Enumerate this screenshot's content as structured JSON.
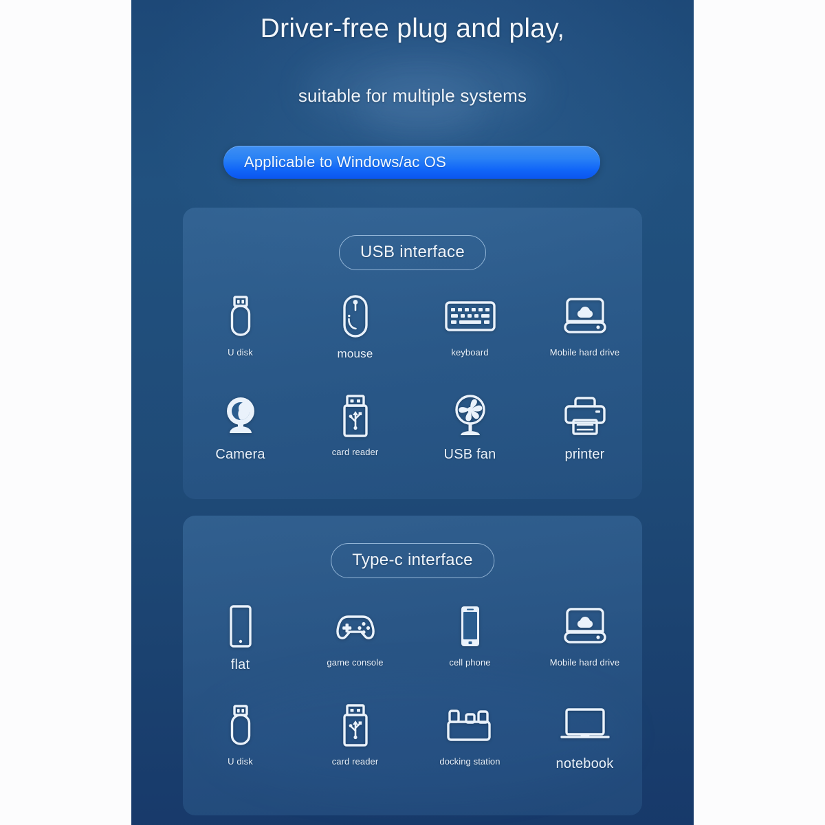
{
  "headline": "Driver-free plug and play,",
  "subheadline": "suitable for multiple systems",
  "os_button": {
    "label": "Applicable to Windows/ac OS"
  },
  "colors": {
    "background_top": "#1d4877",
    "background_bottom": "#17396a",
    "card": "#3d6e9f",
    "accent_button_light": "#3f8ff2",
    "accent_button_dark": "#0b56ef",
    "icon_stroke": "#eaf2fb",
    "text": "#f2f6fb"
  },
  "sections": [
    {
      "title": "USB interface",
      "rows": [
        [
          {
            "icon": "usb-flash-drive-icon",
            "label": "U disk",
            "size": "sm"
          },
          {
            "icon": "mouse-icon",
            "label": "mouse",
            "size": "md"
          },
          {
            "icon": "keyboard-icon",
            "label": "keyboard",
            "size": "sm"
          },
          {
            "icon": "external-hard-drive-icon",
            "label": "Mobile hard drive",
            "size": "sm"
          }
        ],
        [
          {
            "icon": "webcam-icon",
            "label": "Camera",
            "size": "lg"
          },
          {
            "icon": "card-reader-icon",
            "label": "card reader",
            "size": "sm"
          },
          {
            "icon": "usb-fan-icon",
            "label": "USB fan",
            "size": "lg"
          },
          {
            "icon": "printer-icon",
            "label": "printer",
            "size": "lg"
          }
        ]
      ]
    },
    {
      "title": "Type-c interface",
      "rows": [
        [
          {
            "icon": "tablet-icon",
            "label": "flat",
            "size": "lg"
          },
          {
            "icon": "game-controller-icon",
            "label": "game console",
            "size": "sm"
          },
          {
            "icon": "smartphone-icon",
            "label": "cell phone",
            "size": "sm"
          },
          {
            "icon": "external-hard-drive-icon",
            "label": "Mobile hard drive",
            "size": "sm"
          }
        ],
        [
          {
            "icon": "usb-flash-drive-icon",
            "label": "U disk",
            "size": "sm"
          },
          {
            "icon": "card-reader-icon",
            "label": "card reader",
            "size": "sm"
          },
          {
            "icon": "docking-station-icon",
            "label": "docking station",
            "size": "sm"
          },
          {
            "icon": "laptop-icon",
            "label": "notebook",
            "size": "lg"
          }
        ]
      ]
    }
  ]
}
